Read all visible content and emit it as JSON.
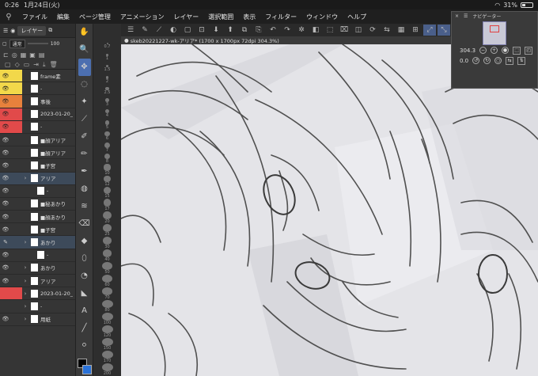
{
  "status": {
    "time": "0:26",
    "date": "1月24日(火)",
    "battery": "31%",
    "battery_level": 0.31
  },
  "menu": {
    "items": [
      "ファイル",
      "編集",
      "ページ管理",
      "アニメーション",
      "レイヤー",
      "選択範囲",
      "表示",
      "フィルター",
      "ウィンドウ",
      "ヘルプ"
    ]
  },
  "layer_panel": {
    "title": "レイヤー",
    "blend_mode": "通常",
    "opacity": "100",
    "layers": [
      {
        "name": "frame素",
        "eye": "👁",
        "color": "yellow",
        "indent": 0,
        "active": false
      },
      {
        "name": "-",
        "eye": "👁",
        "color": "yellow",
        "indent": 0,
        "active": false
      },
      {
        "name": "事後",
        "eye": "👁",
        "color": "orange",
        "indent": 0,
        "active": false
      },
      {
        "name": "2023-01-20_",
        "eye": "👁",
        "color": "red",
        "indent": 0,
        "active": false
      },
      {
        "name": "-",
        "eye": "👁",
        "color": "red",
        "indent": 0,
        "active": false
      },
      {
        "name": "■顔アリア",
        "eye": "👁",
        "color": "",
        "indent": 0,
        "active": false
      },
      {
        "name": "■顔アリア",
        "eye": "👁",
        "color": "",
        "indent": 0,
        "active": false
      },
      {
        "name": "■子宮",
        "eye": "👁",
        "color": "",
        "indent": 0,
        "active": false
      },
      {
        "name": "アリア",
        "eye": "👁",
        "color": "",
        "indent": 0,
        "active": true
      },
      {
        "name": "-",
        "eye": "👁",
        "color": "",
        "indent": 1,
        "active": false
      },
      {
        "name": "■秘あかり",
        "eye": "👁",
        "color": "",
        "indent": 0,
        "active": false
      },
      {
        "name": "■顔あかり",
        "eye": "👁",
        "color": "",
        "indent": 0,
        "active": false
      },
      {
        "name": "■子宮",
        "eye": "👁",
        "color": "",
        "indent": 0,
        "active": false
      },
      {
        "name": "あかり",
        "eye": "✎",
        "color": "",
        "indent": 0,
        "active": true
      },
      {
        "name": "-",
        "eye": "👁",
        "color": "",
        "indent": 1,
        "active": false
      },
      {
        "name": "あかり",
        "eye": "👁",
        "color": "",
        "indent": 0,
        "active": false
      },
      {
        "name": "アリア",
        "eye": "👁",
        "color": "",
        "indent": 0,
        "active": false
      },
      {
        "name": "2023-01-20_",
        "eye": "",
        "color": "red",
        "indent": 0,
        "active": false
      },
      {
        "name": "-",
        "eye": "",
        "color": "",
        "indent": 0,
        "active": false
      },
      {
        "name": "用紙",
        "eye": "👁",
        "color": "",
        "indent": 0,
        "active": false
      }
    ]
  },
  "tools": [
    "✋",
    "🔍",
    "✥",
    "◌",
    "✦",
    "⟋",
    "✐",
    "✏",
    "✒",
    "◍",
    "≋",
    "⌫",
    "◆",
    "⬯",
    "◔",
    "◣",
    "A",
    "╱",
    "⚪"
  ],
  "brush_sizes": [
    "0.7",
    "1",
    "1.5",
    "2",
    "2.5",
    "3",
    "4",
    "5",
    "6",
    "7",
    "8",
    "10",
    "12",
    "15",
    "17",
    "20",
    "25",
    "30",
    "40",
    "50",
    "60",
    "70",
    "80",
    "100",
    "120",
    "150",
    "170",
    "200"
  ],
  "document": {
    "tab_title": "skeb20221227-wk-アリア* (1700 x 1700px 72dpi 304.3%)"
  },
  "navigator": {
    "title": "ナビゲーター",
    "zoom": "304.3",
    "rotation": "0.0"
  },
  "colors": {
    "accent": "#4c6fb0",
    "main_color": "#000000",
    "sub_color": "#2a72d8"
  }
}
